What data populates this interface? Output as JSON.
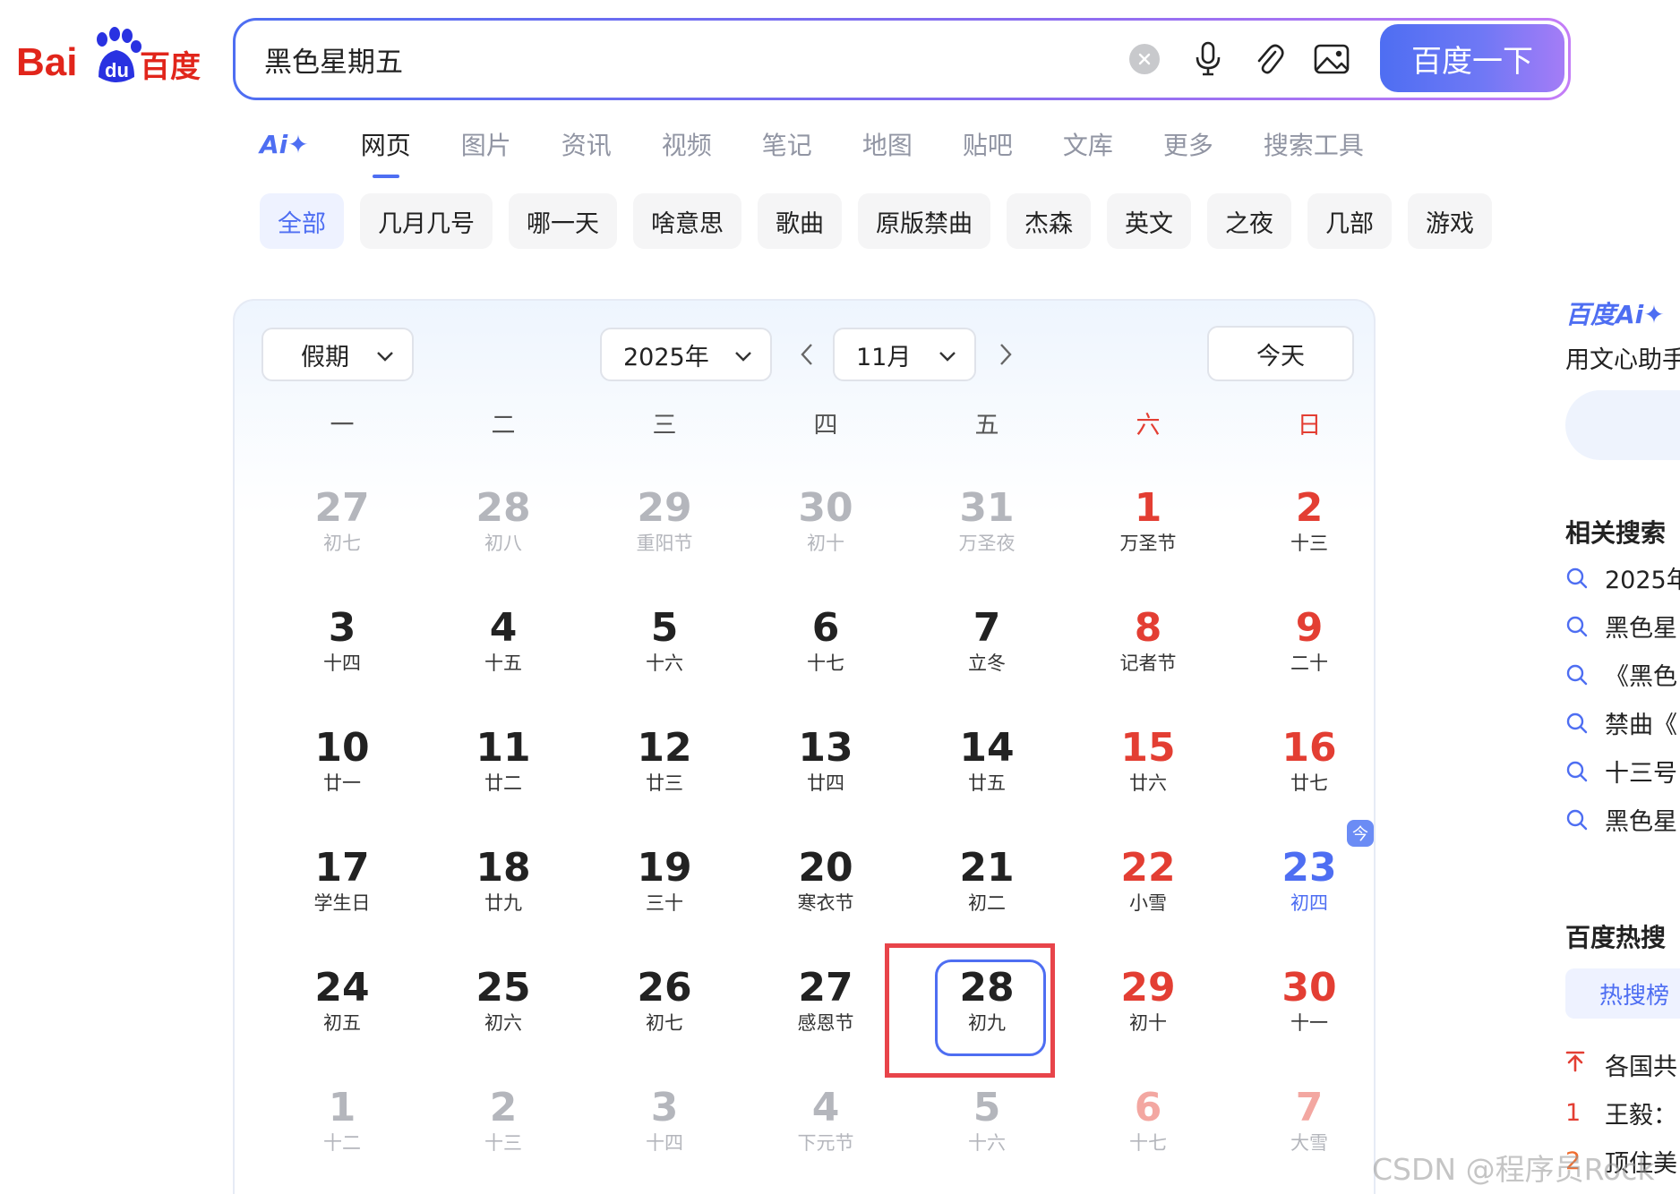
{
  "header": {
    "logo_text_latin": "Bai",
    "logo_text_du": "du",
    "logo_text_cn": "百度",
    "search_value": "黑色星期五",
    "search_button": "百度一下"
  },
  "tabs": [
    {
      "label": "Ai✦"
    },
    {
      "label": "网页"
    },
    {
      "label": "图片"
    },
    {
      "label": "资讯"
    },
    {
      "label": "视频"
    },
    {
      "label": "笔记"
    },
    {
      "label": "地图"
    },
    {
      "label": "贴吧"
    },
    {
      "label": "文库"
    },
    {
      "label": "更多"
    },
    {
      "label": "搜索工具"
    }
  ],
  "chips": [
    "全部",
    "几月几号",
    "哪一天",
    "啥意思",
    "歌曲",
    "原版禁曲",
    "杰森",
    "英文",
    "之夜",
    "几部",
    "游戏"
  ],
  "calendar": {
    "holiday_select": "假期",
    "year_select": "2025年",
    "month_select": "11月",
    "today_button": "今天",
    "today_badge": "今",
    "weekdays": [
      "一",
      "二",
      "三",
      "四",
      "五",
      "六",
      "日"
    ],
    "days": [
      {
        "n": "27",
        "s": "初七",
        "other": true
      },
      {
        "n": "28",
        "s": "初八",
        "other": true
      },
      {
        "n": "29",
        "s": "重阳节",
        "other": true
      },
      {
        "n": "30",
        "s": "初十",
        "other": true
      },
      {
        "n": "31",
        "s": "万圣夜",
        "other": true
      },
      {
        "n": "1",
        "s": "万圣节"
      },
      {
        "n": "2",
        "s": "十三"
      },
      {
        "n": "3",
        "s": "十四"
      },
      {
        "n": "4",
        "s": "十五"
      },
      {
        "n": "5",
        "s": "十六"
      },
      {
        "n": "6",
        "s": "十七"
      },
      {
        "n": "7",
        "s": "立冬"
      },
      {
        "n": "8",
        "s": "记者节"
      },
      {
        "n": "9",
        "s": "二十"
      },
      {
        "n": "10",
        "s": "廿一"
      },
      {
        "n": "11",
        "s": "廿二"
      },
      {
        "n": "12",
        "s": "廿三"
      },
      {
        "n": "13",
        "s": "廿四"
      },
      {
        "n": "14",
        "s": "廿五"
      },
      {
        "n": "15",
        "s": "廿六"
      },
      {
        "n": "16",
        "s": "廿七"
      },
      {
        "n": "17",
        "s": "学生日"
      },
      {
        "n": "18",
        "s": "廿九"
      },
      {
        "n": "19",
        "s": "三十"
      },
      {
        "n": "20",
        "s": "寒衣节"
      },
      {
        "n": "21",
        "s": "初二"
      },
      {
        "n": "22",
        "s": "小雪"
      },
      {
        "n": "23",
        "s": "初四",
        "today": true
      },
      {
        "n": "24",
        "s": "初五"
      },
      {
        "n": "25",
        "s": "初六"
      },
      {
        "n": "26",
        "s": "初七"
      },
      {
        "n": "27",
        "s": "感恩节"
      },
      {
        "n": "28",
        "s": "初九",
        "selected": true
      },
      {
        "n": "29",
        "s": "初十"
      },
      {
        "n": "30",
        "s": "十一"
      },
      {
        "n": "1",
        "s": "十二",
        "other": true
      },
      {
        "n": "2",
        "s": "十三",
        "other": true
      },
      {
        "n": "3",
        "s": "十四",
        "other": true
      },
      {
        "n": "4",
        "s": "下元节",
        "other": true
      },
      {
        "n": "5",
        "s": "十六",
        "other": true
      },
      {
        "n": "6",
        "s": "十七",
        "other": true
      },
      {
        "n": "7",
        "s": "大雪",
        "other": true
      }
    ]
  },
  "sidebar": {
    "ai_brand": "百度Ai✦",
    "ai_subtitle": "用文心助手",
    "related_title": "相关搜索",
    "related": [
      "2025年",
      "黑色星",
      "《黑色",
      "禁曲《",
      "十三号",
      "黑色星"
    ],
    "hot_title": "百度热搜",
    "hot_tab": "热搜榜",
    "hot_items": [
      {
        "rank": "",
        "text": "各国共"
      },
      {
        "rank": "1",
        "text": "王毅："
      },
      {
        "rank": "2",
        "text": "顶住美"
      }
    ]
  },
  "watermark": "CSDN @程序员Rock",
  "colors": {
    "accent": "#4e6ef2",
    "weekend_red": "#e33e33",
    "highlight_box": "#e8444a"
  }
}
